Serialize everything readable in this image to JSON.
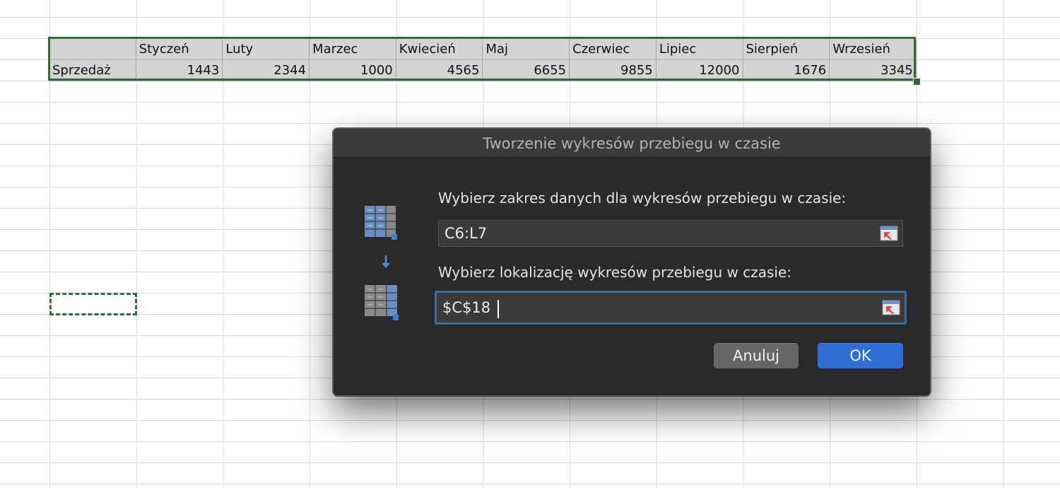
{
  "spreadsheet": {
    "header_row": [
      "",
      "Styczeń",
      "Luty",
      "Marzec",
      "Kwiecień",
      "Maj",
      "Czerwiec",
      "Lipiec",
      "Sierpień",
      "Wrzesień"
    ],
    "data_row_label": "Sprzedaż",
    "data_row_values": [
      "1443",
      "2344",
      "1000",
      "4565",
      "6655",
      "9855",
      "12000",
      "1676",
      "3345"
    ]
  },
  "dialog": {
    "title": "Tworzenie wykresów przebiegu w czasie",
    "data_range_label": "Wybierz zakres danych dla wykresów przebiegu w czasie:",
    "data_range_value": "C6:L7",
    "location_label": "Wybierz lokalizację wykresów przebiegu w czasie:",
    "location_value": "$C$18",
    "cancel_label": "Anuluj",
    "ok_label": "OK"
  },
  "icons": {
    "range_icon": "table-range-icon",
    "arrow_icon": "arrow-down-icon",
    "location_icon": "table-location-icon",
    "collapse_icon": "collapse-dialog-icon"
  },
  "colors": {
    "selection_green": "#2f6b3f",
    "ok_blue": "#2f6fd6",
    "focus_ring": "#3b6d9e"
  }
}
